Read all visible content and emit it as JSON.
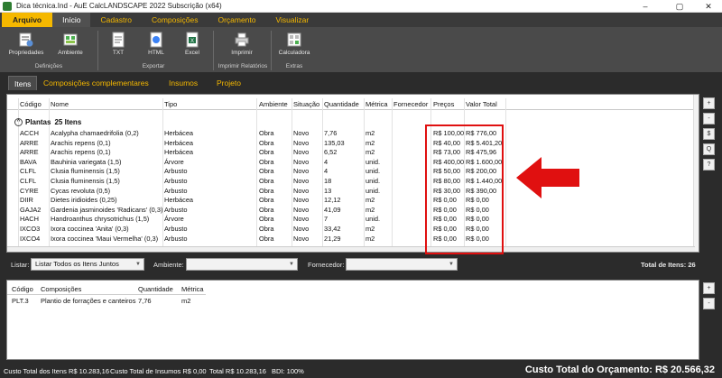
{
  "window": {
    "title": "Dica técnica.Ind - AuE CalcLANDSCAPE 2022 Subscrição (x64)"
  },
  "window_controls": {
    "minimize": "–",
    "maximize": "▢",
    "close": "✕"
  },
  "menu": {
    "tabs": [
      "Arquivo",
      "Início",
      "Cadastro",
      "Composições",
      "Orçamento",
      "Visualizar"
    ]
  },
  "ribbon": {
    "buttons": [
      "Propriedades",
      "Ambiente",
      "TXT",
      "HTML",
      "Excel",
      "Imprimir",
      "Calculadora"
    ],
    "groups": [
      "Definições",
      "Exportar",
      "Imprimir Relatórios",
      "Extras"
    ]
  },
  "content_tabs": [
    "Itens",
    "Composições complementares",
    "Insumos",
    "Projeto"
  ],
  "table": {
    "columns": [
      "Código",
      "Nome",
      "Tipo",
      "Ambiente",
      "Situação",
      "Quantidade",
      "Métrica",
      "Fornecedor",
      "Preços",
      "Valor Total"
    ],
    "group_label": "Plantas",
    "group_count": "25 Itens",
    "rows": [
      [
        "ACCH",
        "Acalypha chamaedrifolia (0,2)",
        "Herbácea",
        "Obra",
        "Novo",
        "7,76",
        "m2",
        "",
        "R$ 100,00",
        "R$ 776,00"
      ],
      [
        "ARRE",
        "Arachis repens (0,1)",
        "Herbácea",
        "Obra",
        "Novo",
        "135,03",
        "m2",
        "",
        "R$ 40,00",
        "R$ 5.401,20"
      ],
      [
        "ARRE",
        "Arachis repens (0,1)",
        "Herbácea",
        "Obra",
        "Novo",
        "6,52",
        "m2",
        "",
        "R$ 73,00",
        "R$ 475,96"
      ],
      [
        "BAVA",
        "Bauhinia variegata (1,5)",
        "Árvore",
        "Obra",
        "Novo",
        "4",
        "unid.",
        "",
        "R$ 400,00",
        "R$ 1.600,00"
      ],
      [
        "CLFL",
        "Clusia fluminensis (1,5)",
        "Arbusto",
        "Obra",
        "Novo",
        "4",
        "unid.",
        "",
        "R$ 50,00",
        "R$ 200,00"
      ],
      [
        "CLFL",
        "Clusia fluminensis (1,5)",
        "Arbusto",
        "Obra",
        "Novo",
        "18",
        "unid.",
        "",
        "R$ 80,00",
        "R$ 1.440,00"
      ],
      [
        "CYRE",
        "Cycas revoluta (0,5)",
        "Arbusto",
        "Obra",
        "Novo",
        "13",
        "unid.",
        "",
        "R$ 30,00",
        "R$ 390,00"
      ],
      [
        "DIIR",
        "Dietes iridioides (0,25)",
        "Herbácea",
        "Obra",
        "Novo",
        "12,12",
        "m2",
        "",
        "R$ 0,00",
        "R$ 0,00"
      ],
      [
        "GAJA2",
        "Gardenia jasminoides 'Radicans' (0,3)",
        "Arbusto",
        "Obra",
        "Novo",
        "41,09",
        "m2",
        "",
        "R$ 0,00",
        "R$ 0,00"
      ],
      [
        "HACH",
        "Handroanthus chrysotrichus (1,5)",
        "Árvore",
        "Obra",
        "Novo",
        "7",
        "unid.",
        "",
        "R$ 0,00",
        "R$ 0,00"
      ],
      [
        "IXCO3",
        "Ixora coccinea 'Anita' (0,3)",
        "Arbusto",
        "Obra",
        "Novo",
        "33,42",
        "m2",
        "",
        "R$ 0,00",
        "R$ 0,00"
      ],
      [
        "IXCO4",
        "Ixora coccinea 'Maui Vermelha' (0,3)",
        "Arbusto",
        "Obra",
        "Novo",
        "21,29",
        "m2",
        "",
        "R$ 0,00",
        "R$ 0,00"
      ]
    ]
  },
  "side_buttons": [
    "+",
    "-",
    "$",
    "Q",
    "?"
  ],
  "filters": {
    "listar_label": "Listar:",
    "listar_value": "Listar Todos os Itens Juntos",
    "ambiente_label": "Ambiente:",
    "ambiente_value": "",
    "fornecedor_label": "Fornecedor:",
    "fornecedor_value": "",
    "total_itens": "Total de Itens: 26"
  },
  "compositions": {
    "columns": [
      "Código",
      "Composições",
      "Quantidade",
      "Métrica"
    ],
    "rows": [
      [
        "PLT.3",
        "Plantio de forrações e canteiros",
        "7,76",
        "m2"
      ]
    ]
  },
  "bottom_side_buttons": [
    "+",
    "-"
  ],
  "status": {
    "custo_itens": "Custo Total dos Itens R$ 10.283,16",
    "custo_insumos": "Custo Total de Insumos R$ 0,00",
    "total": "Total R$ 10.283,16",
    "bdi": "BDI: 100%",
    "custo_orcamento": "Custo Total do Orçamento: R$ 20.566,32"
  },
  "colors": {
    "accent": "#f5b800",
    "highlight": "#e01010",
    "dark": "#2b2b2b"
  }
}
